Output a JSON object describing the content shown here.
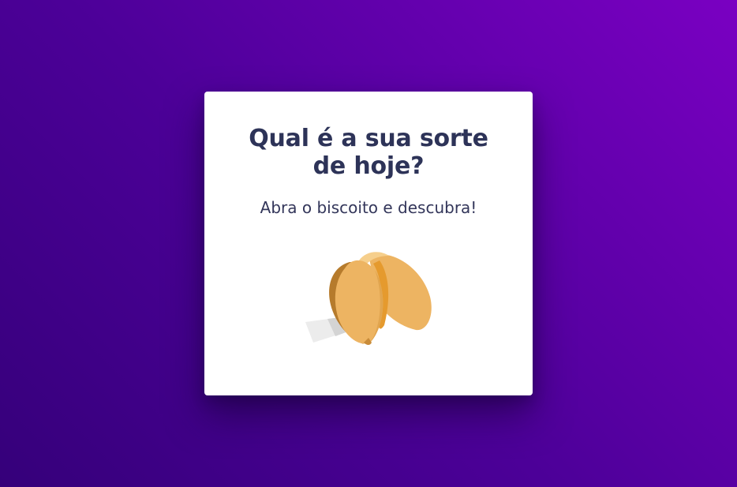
{
  "card": {
    "title": "Qual é a sua sorte de hoje?",
    "subtitle": "Abra o biscoito e descubra!"
  },
  "cookie": {
    "icon": "fortune-cookie-icon"
  },
  "colors": {
    "background_start": "#35007a",
    "background_end": "#7a00c2",
    "title": "#2d3358",
    "cookie": "#edb462",
    "cookie_shadow": "#e59a2e",
    "paper": "#e3e3e3"
  }
}
